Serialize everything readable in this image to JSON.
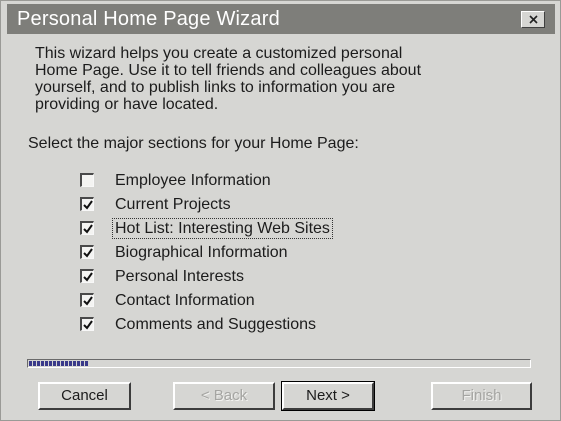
{
  "window": {
    "title": "Personal Home Page Wizard"
  },
  "intro": "This wizard helps you create a customized personal\nHome Page. Use it to tell friends and colleagues about\nyourself, and to publish links to information you are\nproviding or have located.",
  "prompt": "Select the major sections for your Home Page:",
  "sections": [
    {
      "label": "Employee Information",
      "checked": false
    },
    {
      "label": "Current Projects",
      "checked": true
    },
    {
      "label": "Hot List: Interesting Web Sites",
      "checked": true,
      "focused": true
    },
    {
      "label": "Biographical Information",
      "checked": true
    },
    {
      "label": "Personal Interests",
      "checked": true
    },
    {
      "label": "Contact Information",
      "checked": true
    },
    {
      "label": "Comments and Suggestions",
      "checked": true
    }
  ],
  "progress": {
    "fraction": 0.12
  },
  "buttons": {
    "cancel": "Cancel",
    "back": "< Back",
    "next": "Next >",
    "finish": "Finish"
  },
  "icons": {
    "close": "close-icon",
    "check": "checkmark-icon"
  }
}
